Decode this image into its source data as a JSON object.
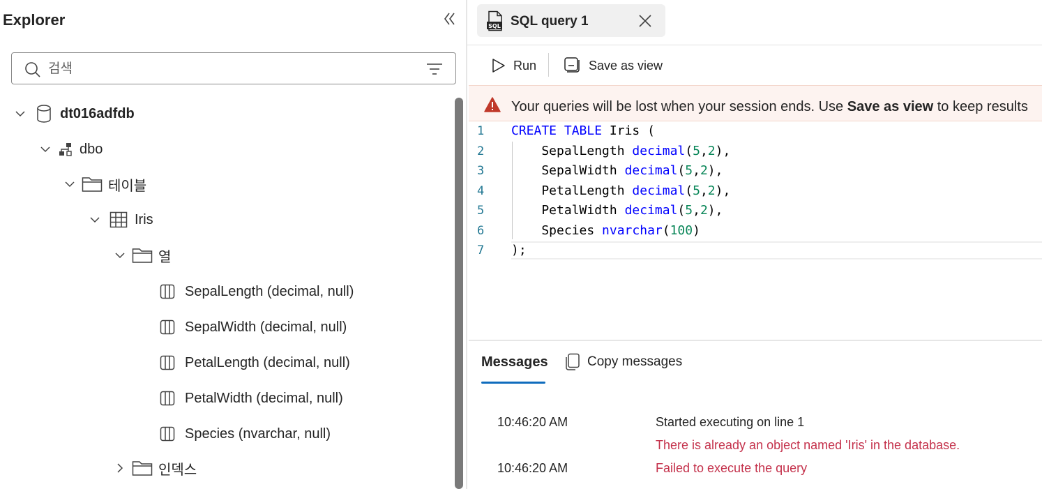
{
  "explorer": {
    "title": "Explorer",
    "search_placeholder": "검색",
    "tree": {
      "database": "dt016adfdb",
      "schema": "dbo",
      "tables_folder": "테이블",
      "table": "Iris",
      "columns_folder": "열",
      "columns": [
        "SepalLength (decimal, null)",
        "SepalWidth (decimal, null)",
        "PetalLength (decimal, null)",
        "PetalWidth (decimal, null)",
        "Species (nvarchar, null)"
      ],
      "indexes_folder": "인덱스"
    }
  },
  "tab": {
    "label": "SQL query 1",
    "icon_text": "SQL"
  },
  "toolbar": {
    "run_label": "Run",
    "save_as_view_label": "Save as view"
  },
  "warning": {
    "prefix": "Your queries will be lost when your session ends. Use ",
    "bold": "Save as view",
    "suffix": " to keep results"
  },
  "editor": {
    "line_numbers": [
      "1",
      "2",
      "3",
      "4",
      "5",
      "6",
      "7"
    ],
    "lines": [
      "CREATE TABLE Iris (",
      "    SepalLength decimal(5,2),",
      "    SepalWidth decimal(5,2),",
      "    PetalLength decimal(5,2),",
      "    PetalWidth decimal(5,2),",
      "    Species nvarchar(100)",
      ");"
    ]
  },
  "messages": {
    "tab_label": "Messages",
    "copy_label": "Copy messages",
    "entries": [
      {
        "time": "10:46:20 AM",
        "text": "Started executing on line 1",
        "error": false
      },
      {
        "time": "",
        "text": "There is already an object named 'Iris' in the database.",
        "error": true
      },
      {
        "time": "10:46:20 AM",
        "text": "Failed to execute the query",
        "error": true
      }
    ]
  },
  "colors": {
    "accent": "#0f6cbd",
    "error_text": "#c4314b",
    "warning_icon": "#c0392b",
    "keyword": "#0000ff",
    "number": "#098658"
  }
}
